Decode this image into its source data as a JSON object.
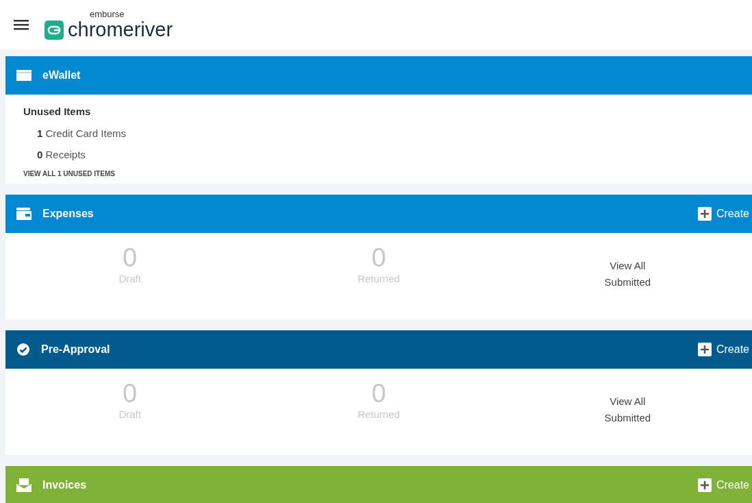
{
  "header": {
    "logo_top": "emburse",
    "logo_main": "chromeriver"
  },
  "sections": [
    {
      "kind": "ewallet",
      "title": "eWallet",
      "color": "#0389d1",
      "unused": {
        "heading": "Unused Items",
        "items": [
          {
            "count": "1",
            "label": "Credit Card Items"
          },
          {
            "count": "0",
            "label": "Receipts"
          }
        ],
        "link": "VIEW ALL 1 UNUSED ITEMS"
      }
    },
    {
      "kind": "expenses",
      "title": "Expenses",
      "color": "#0389d1",
      "create": "Create",
      "stats": [
        {
          "value": "0",
          "label": "Draft"
        },
        {
          "value": "0",
          "label": "Returned"
        }
      ],
      "view_all": "View All Submitted"
    },
    {
      "kind": "preapproval",
      "title": "Pre-Approval",
      "color": "#035a8c",
      "create": "Create",
      "stats": [
        {
          "value": "0",
          "label": "Draft"
        },
        {
          "value": "0",
          "label": "Returned"
        }
      ],
      "view_all": "View All Submitted"
    },
    {
      "kind": "invoices",
      "title": "Invoices",
      "color": "#80b23a",
      "create": "Create"
    }
  ]
}
